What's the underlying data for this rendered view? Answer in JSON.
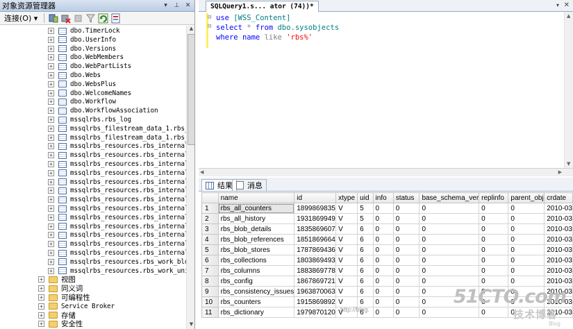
{
  "object_explorer": {
    "title": "对象资源管理器",
    "pin_glyph": "▾",
    "pushpin_glyph": "⊥",
    "close_glyph": "✕",
    "connect_label": "连接(O) ▾",
    "tree_items": [
      {
        "label": "dbo.TimerLock",
        "type": "table",
        "expand": "+"
      },
      {
        "label": "dbo.UserInfo",
        "type": "table",
        "expand": "+"
      },
      {
        "label": "dbo.Versions",
        "type": "table",
        "expand": "+"
      },
      {
        "label": "dbo.WebMembers",
        "type": "table",
        "expand": "+"
      },
      {
        "label": "dbo.WebPartLists",
        "type": "table",
        "expand": "+"
      },
      {
        "label": "dbo.Webs",
        "type": "table",
        "expand": "+"
      },
      {
        "label": "dbo.WebsPlus",
        "type": "table",
        "expand": "+"
      },
      {
        "label": "dbo.WelcomeNames",
        "type": "table",
        "expand": "+"
      },
      {
        "label": "dbo.Workflow",
        "type": "table",
        "expand": "+"
      },
      {
        "label": "dbo.WorkflowAssociation",
        "type": "table",
        "expand": "+"
      },
      {
        "label": "mssqlrbs.rbs_log",
        "type": "table",
        "expand": "+"
      },
      {
        "label": "mssqlrbs_filestream_data_1.rbs_file",
        "type": "table",
        "expand": "+"
      },
      {
        "label": "mssqlrbs_filestream_data_1.rbs_file",
        "type": "table",
        "expand": "+"
      },
      {
        "label": "mssqlrbs_resources.rbs_internal_blo",
        "type": "table",
        "expand": "+"
      },
      {
        "label": "mssqlrbs_resources.rbs_internal_blo",
        "type": "table",
        "expand": "+"
      },
      {
        "label": "mssqlrbs_resources.rbs_internal_blo",
        "type": "table",
        "expand": "+"
      },
      {
        "label": "mssqlrbs_resources.rbs_internal_col",
        "type": "table",
        "expand": "+"
      },
      {
        "label": "mssqlrbs_resources.rbs_internal_col",
        "type": "table",
        "expand": "+"
      },
      {
        "label": "mssqlrbs_resources.rbs_internal_con",
        "type": "table",
        "expand": "+"
      },
      {
        "label": "mssqlrbs_resources.rbs_internal_con",
        "type": "table",
        "expand": "+"
      },
      {
        "label": "mssqlrbs_resources.rbs_internal_cou",
        "type": "table",
        "expand": "+"
      },
      {
        "label": "mssqlrbs_resources.rbs_internal_del",
        "type": "table",
        "expand": "+"
      },
      {
        "label": "mssqlrbs_resources.rbs_internal_dic",
        "type": "table",
        "expand": "+"
      },
      {
        "label": "mssqlrbs_resources.rbs_internal_his",
        "type": "table",
        "expand": "+"
      },
      {
        "label": "mssqlrbs_resources.rbs_internal_ind",
        "type": "table",
        "expand": "+"
      },
      {
        "label": "mssqlrbs_resources.rbs_internal_poo",
        "type": "table",
        "expand": "+"
      },
      {
        "label": "mssqlrbs_resources.rbs_work_blob_st",
        "type": "table",
        "expand": "+"
      },
      {
        "label": "mssqlrbs_resources.rbs_work_units",
        "type": "table",
        "expand": "+"
      }
    ],
    "folders": [
      {
        "label": "视图",
        "expand": "+"
      },
      {
        "label": "同义词",
        "expand": "+"
      },
      {
        "label": "可编程性",
        "expand": "+"
      },
      {
        "label": "Service Broker",
        "expand": "+"
      },
      {
        "label": "存储",
        "expand": "+"
      },
      {
        "label": "安全性",
        "expand": "+"
      }
    ]
  },
  "editor": {
    "tab_title": "SQLQuery1.s... ator (74))*",
    "tab_menu_glyph": "▾",
    "tab_close_glyph": "✕",
    "code": {
      "line1_kw": "use",
      "line1_obj": "[WSS_Content]",
      "line2_kw1": "select",
      "line2_star": "*",
      "line2_kw2": "from",
      "line2_obj": "dbo.sysobjects",
      "line3_kw": "where",
      "line3_col": "name",
      "line3_op": "like",
      "line3_str": "'rbs%'"
    },
    "fold_minus": "⊟",
    "scroll_up": "▲",
    "scroll_down": "▼",
    "scroll_left": "◀",
    "scroll_right": "▶"
  },
  "results": {
    "tab_results": "结果",
    "tab_messages": "消息",
    "columns": [
      "name",
      "id",
      "xtype",
      "uid",
      "info",
      "status",
      "base_schema_ver",
      "replinfo",
      "parent_obj",
      "crdate"
    ],
    "rows": [
      [
        "1",
        "rbs_all_counters",
        "1899869835",
        "V",
        "5",
        "0",
        "0",
        "0",
        "0",
        "0",
        "2010-03"
      ],
      [
        "2",
        "rbs_all_history",
        "1931869949",
        "V",
        "5",
        "0",
        "0",
        "0",
        "0",
        "0",
        "2010-03"
      ],
      [
        "3",
        "rbs_blob_details",
        "1835869607",
        "V",
        "6",
        "0",
        "0",
        "0",
        "0",
        "0",
        "2010-03"
      ],
      [
        "4",
        "rbs_blob_references",
        "1851869664",
        "V",
        "6",
        "0",
        "0",
        "0",
        "0",
        "0",
        "2010-03"
      ],
      [
        "5",
        "rbs_blob_stores",
        "1787869436",
        "V",
        "6",
        "0",
        "0",
        "0",
        "0",
        "0",
        "2010-03"
      ],
      [
        "6",
        "rbs_collections",
        "1803869493",
        "V",
        "6",
        "0",
        "0",
        "0",
        "0",
        "0",
        "2010-03"
      ],
      [
        "7",
        "rbs_columns",
        "1883869778",
        "V",
        "6",
        "0",
        "0",
        "0",
        "0",
        "0",
        "2010-03"
      ],
      [
        "8",
        "rbs_config",
        "1867869721",
        "V",
        "6",
        "0",
        "0",
        "0",
        "0",
        "0",
        "2010-03"
      ],
      [
        "9",
        "rbs_consistency_issues",
        "1963870063",
        "V",
        "6",
        "0",
        "0",
        "0",
        "0",
        "0",
        "2010-03"
      ],
      [
        "10",
        "rbs_counters",
        "1915869892",
        "V",
        "6",
        "0",
        "0",
        "0",
        "0",
        "0",
        "2010-03"
      ],
      [
        "11",
        "rbs_dictionary",
        "1979870120",
        "V",
        "6",
        "0",
        "0",
        "0",
        "0",
        "0",
        "2010-03"
      ]
    ]
  },
  "watermark": {
    "brand": "51CTO.com",
    "cn": "技术博客",
    "sub": "Blog",
    "url": "http://blog."
  }
}
